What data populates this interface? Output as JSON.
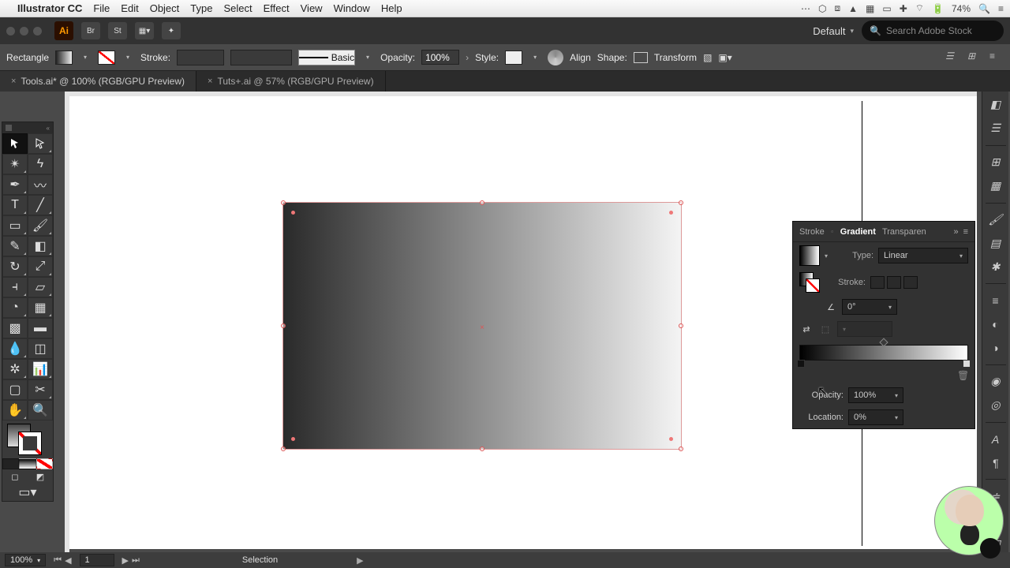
{
  "mac_menu": {
    "app": "Illustrator CC",
    "items": [
      "File",
      "Edit",
      "Object",
      "Type",
      "Select",
      "Effect",
      "View",
      "Window",
      "Help"
    ],
    "battery": "74%"
  },
  "workspace_name": "Default",
  "search_placeholder": "Search Adobe Stock",
  "control": {
    "object_label": "Rectangle",
    "stroke_label": "Stroke:",
    "brush_label": "Basic",
    "opacity_label": "Opacity:",
    "opacity_value": "100%",
    "style_label": "Style:",
    "align_label": "Align",
    "shape_label": "Shape:",
    "transform_label": "Transform"
  },
  "tabs": [
    {
      "label": "Tools.ai* @ 100% (RGB/GPU Preview)",
      "active": true
    },
    {
      "label": "Tuts+.ai @ 57% (RGB/GPU Preview)",
      "active": false
    }
  ],
  "gradient_panel": {
    "tabs": [
      "Stroke",
      "Gradient",
      "Transparen"
    ],
    "active_tab": "Gradient",
    "type_label": "Type:",
    "type_value": "Linear",
    "stroke_label": "Stroke:",
    "angle_value": "0°",
    "opacity_label": "Opacity:",
    "opacity_value": "100%",
    "location_label": "Location:",
    "location_value": "0%"
  },
  "status": {
    "zoom": "100%",
    "artboard": "1",
    "tool": "Selection"
  }
}
